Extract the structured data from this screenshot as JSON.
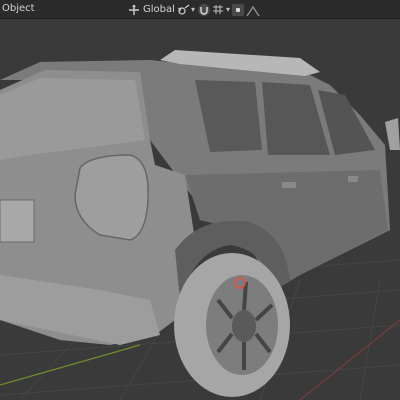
{
  "header": {
    "menu_object": "Object",
    "orientation_label": "Global",
    "icons": [
      "transform-orientation-icon",
      "pivot-icon",
      "snap-icon",
      "snap-grid-icon",
      "proportional-editing-icon",
      "falloff-icon"
    ]
  },
  "viewport": {
    "background": "#3a3a3a",
    "grid_color": "#454545",
    "axis_x_color": "#8a3a3a",
    "axis_y_color": "#6e8a2e",
    "model_color": "#8f8f8f",
    "selection_color": "#e0553a"
  }
}
